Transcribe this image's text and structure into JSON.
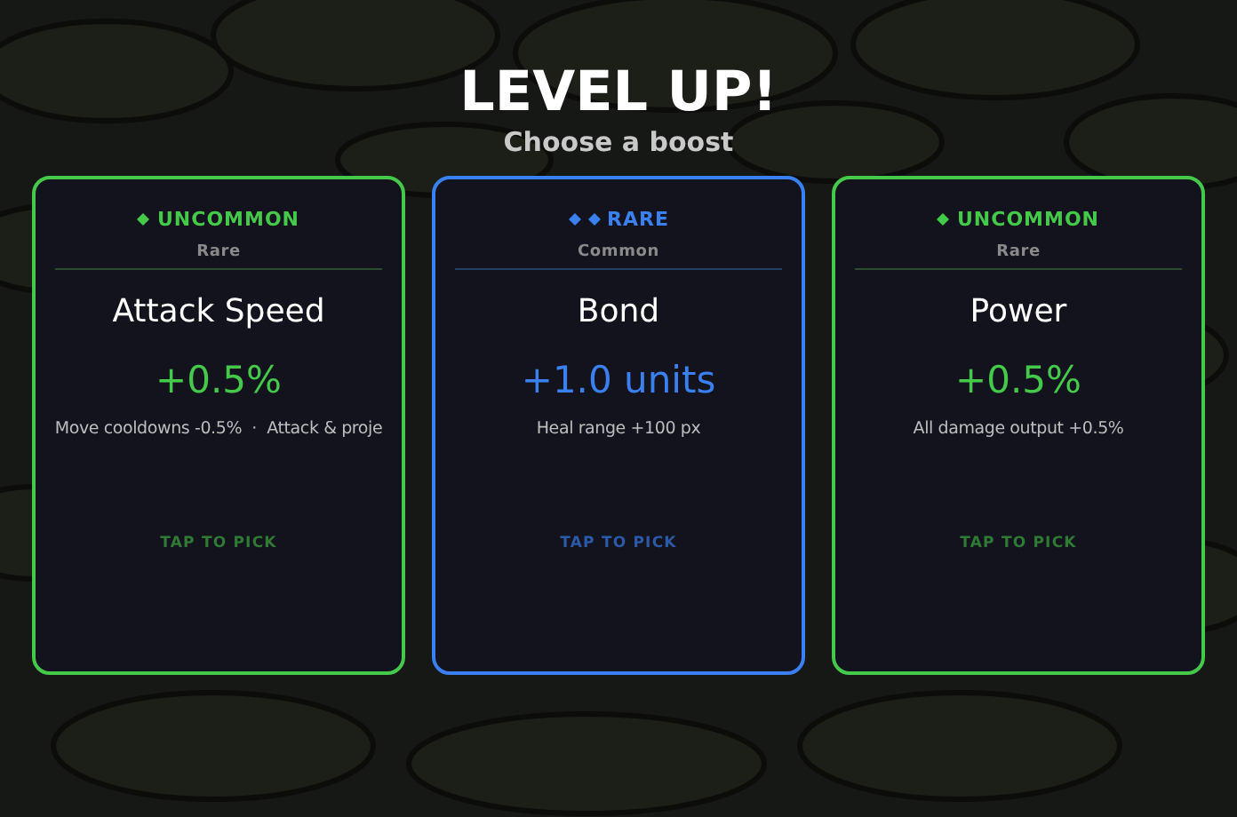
{
  "title": "LEVEL UP!",
  "subtitle": "Choose a boost",
  "cards": [
    {
      "kind": "uncommon",
      "rarity": "UNCOMMON",
      "tier": "Rare",
      "name": "Attack Speed",
      "value": "+0.5%",
      "description": "Move cooldowns -0.5%  ·  Attack & proje",
      "action": "TAP TO PICK"
    },
    {
      "kind": "rare",
      "rarity": "RARE",
      "tier": "Common",
      "name": "Bond",
      "value": "+1.0 units",
      "description": "Heal range +100 px",
      "action": "TAP TO PICK"
    },
    {
      "kind": "uncommon",
      "rarity": "UNCOMMON",
      "tier": "Rare",
      "name": "Power",
      "value": "+0.5%",
      "description": "All damage output +0.5%",
      "action": "TAP TO PICK"
    }
  ]
}
